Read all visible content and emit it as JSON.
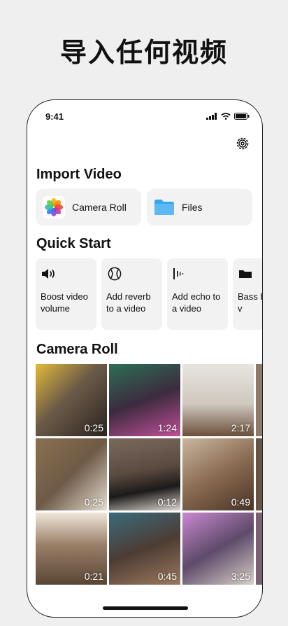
{
  "headline": "导入任何视频",
  "status": {
    "time": "9:41"
  },
  "sections": {
    "import_title": "Import Video",
    "quickstart_title": "Quick Start",
    "camera_title": "Camera Roll"
  },
  "import": {
    "camera_roll": "Camera Roll",
    "files": "Files"
  },
  "quick_start": [
    {
      "label": "Boost video volume",
      "icon": "speaker-icon"
    },
    {
      "label": "Add reverb to a video",
      "icon": "reverb-icon"
    },
    {
      "label": "Add echo to a video",
      "icon": "echo-icon"
    },
    {
      "label": "Bass b your v",
      "icon": "bass-icon"
    }
  ],
  "camera_roll": [
    {
      "duration": "0:25",
      "color": "#6b5a48"
    },
    {
      "duration": "1:24",
      "color": "#3c2b3e"
    },
    {
      "duration": "2:17",
      "color": "#cfc8bf"
    },
    {
      "duration": "0:25",
      "color": "#6e5a47"
    },
    {
      "duration": "0:12",
      "color": "#5a4a40"
    },
    {
      "duration": "0:49",
      "color": "#8a6b52"
    },
    {
      "duration": "0:21",
      "color": "#9a7f68"
    },
    {
      "duration": "0:45",
      "color": "#4d3c34"
    },
    {
      "duration": "3:25",
      "color": "#5e4a6a"
    }
  ],
  "colors": {
    "folder": "#38a7f0",
    "card_bg": "#f2f2f2",
    "page_bg": "#efefef"
  }
}
